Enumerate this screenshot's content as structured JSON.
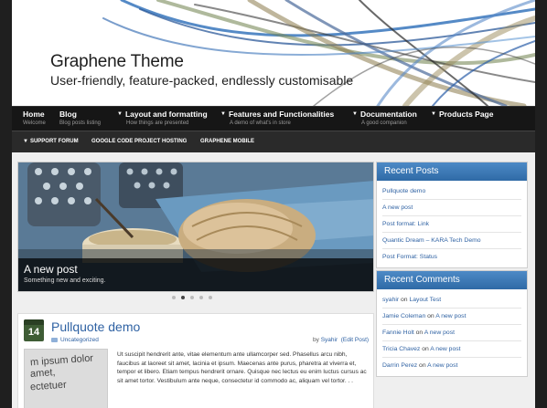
{
  "header": {
    "title": "Graphene Theme",
    "description": "User-friendly, feature-packed, endlessly customisable"
  },
  "nav_primary": [
    {
      "label": "Home",
      "sub": "Welcome",
      "has_children": false
    },
    {
      "label": "Blog",
      "sub": "Blog posts listing",
      "has_children": false
    },
    {
      "label": "Layout and formatting",
      "sub": "How things are presented",
      "has_children": true
    },
    {
      "label": "Features and Functionalities",
      "sub": "A demo of what's in store",
      "has_children": true
    },
    {
      "label": "Documentation",
      "sub": "A good companion",
      "has_children": true
    },
    {
      "label": "Products Page",
      "sub": "",
      "has_children": true
    }
  ],
  "nav_secondary": [
    {
      "label": "SUPPORT FORUM",
      "has_children": true
    },
    {
      "label": "GOOGLE CODE PROJECT HOSTING",
      "has_children": false
    },
    {
      "label": "GRAPHENE MOBILE",
      "has_children": false
    }
  ],
  "slider": {
    "title": "A new post",
    "subtitle": "Something new and exciting.",
    "active_slide": 2,
    "slide_count": 5
  },
  "post": {
    "day": "14",
    "title": "Pullquote demo",
    "category": "Uncategorized",
    "by_prefix": "by",
    "author": "Syahir",
    "edit": "(Edit Post)",
    "thumb_lines": [
      "m ipsum dolor",
      "amet,",
      "ectetuer"
    ],
    "excerpt": "Ut suscipit hendrerit ante, vitae elementum ante ullamcorper sed. Phasellus arcu nibh, faucibus at laoreet sit amet, lacinia et ipsum. Maecenas ante purus, pharetra at viverra et, tempor et libero. Etiam tempus hendrerit ornare. Quisque nec lectus eu enim luctus cursus ac sit amet tortor. Vestibulum ante neque, consectetur id commodo ac, aliquam vel tortor. . ."
  },
  "recent_posts": {
    "title": "Recent Posts",
    "items": [
      "Pullquote demo",
      "A new post",
      "Post format: Link",
      "Quantic Dream – KARA Tech Demo",
      "Post Format: Status"
    ]
  },
  "recent_comments": {
    "title": "Recent Comments",
    "on_word": "on",
    "items": [
      {
        "author": "syahir",
        "post": "Layout Test"
      },
      {
        "author": "Jamie Coleman",
        "post": "A new post"
      },
      {
        "author": "Fannie Holt",
        "post": "A new post"
      },
      {
        "author": "Tricia Chavez",
        "post": "A new post"
      },
      {
        "author": "Darrin Perez",
        "post": "A new post"
      }
    ]
  },
  "colors": {
    "accent": "#2f6aa6",
    "link": "#2f62a3",
    "nav_bg": "#161616",
    "date_badge": "#3e5c35"
  }
}
